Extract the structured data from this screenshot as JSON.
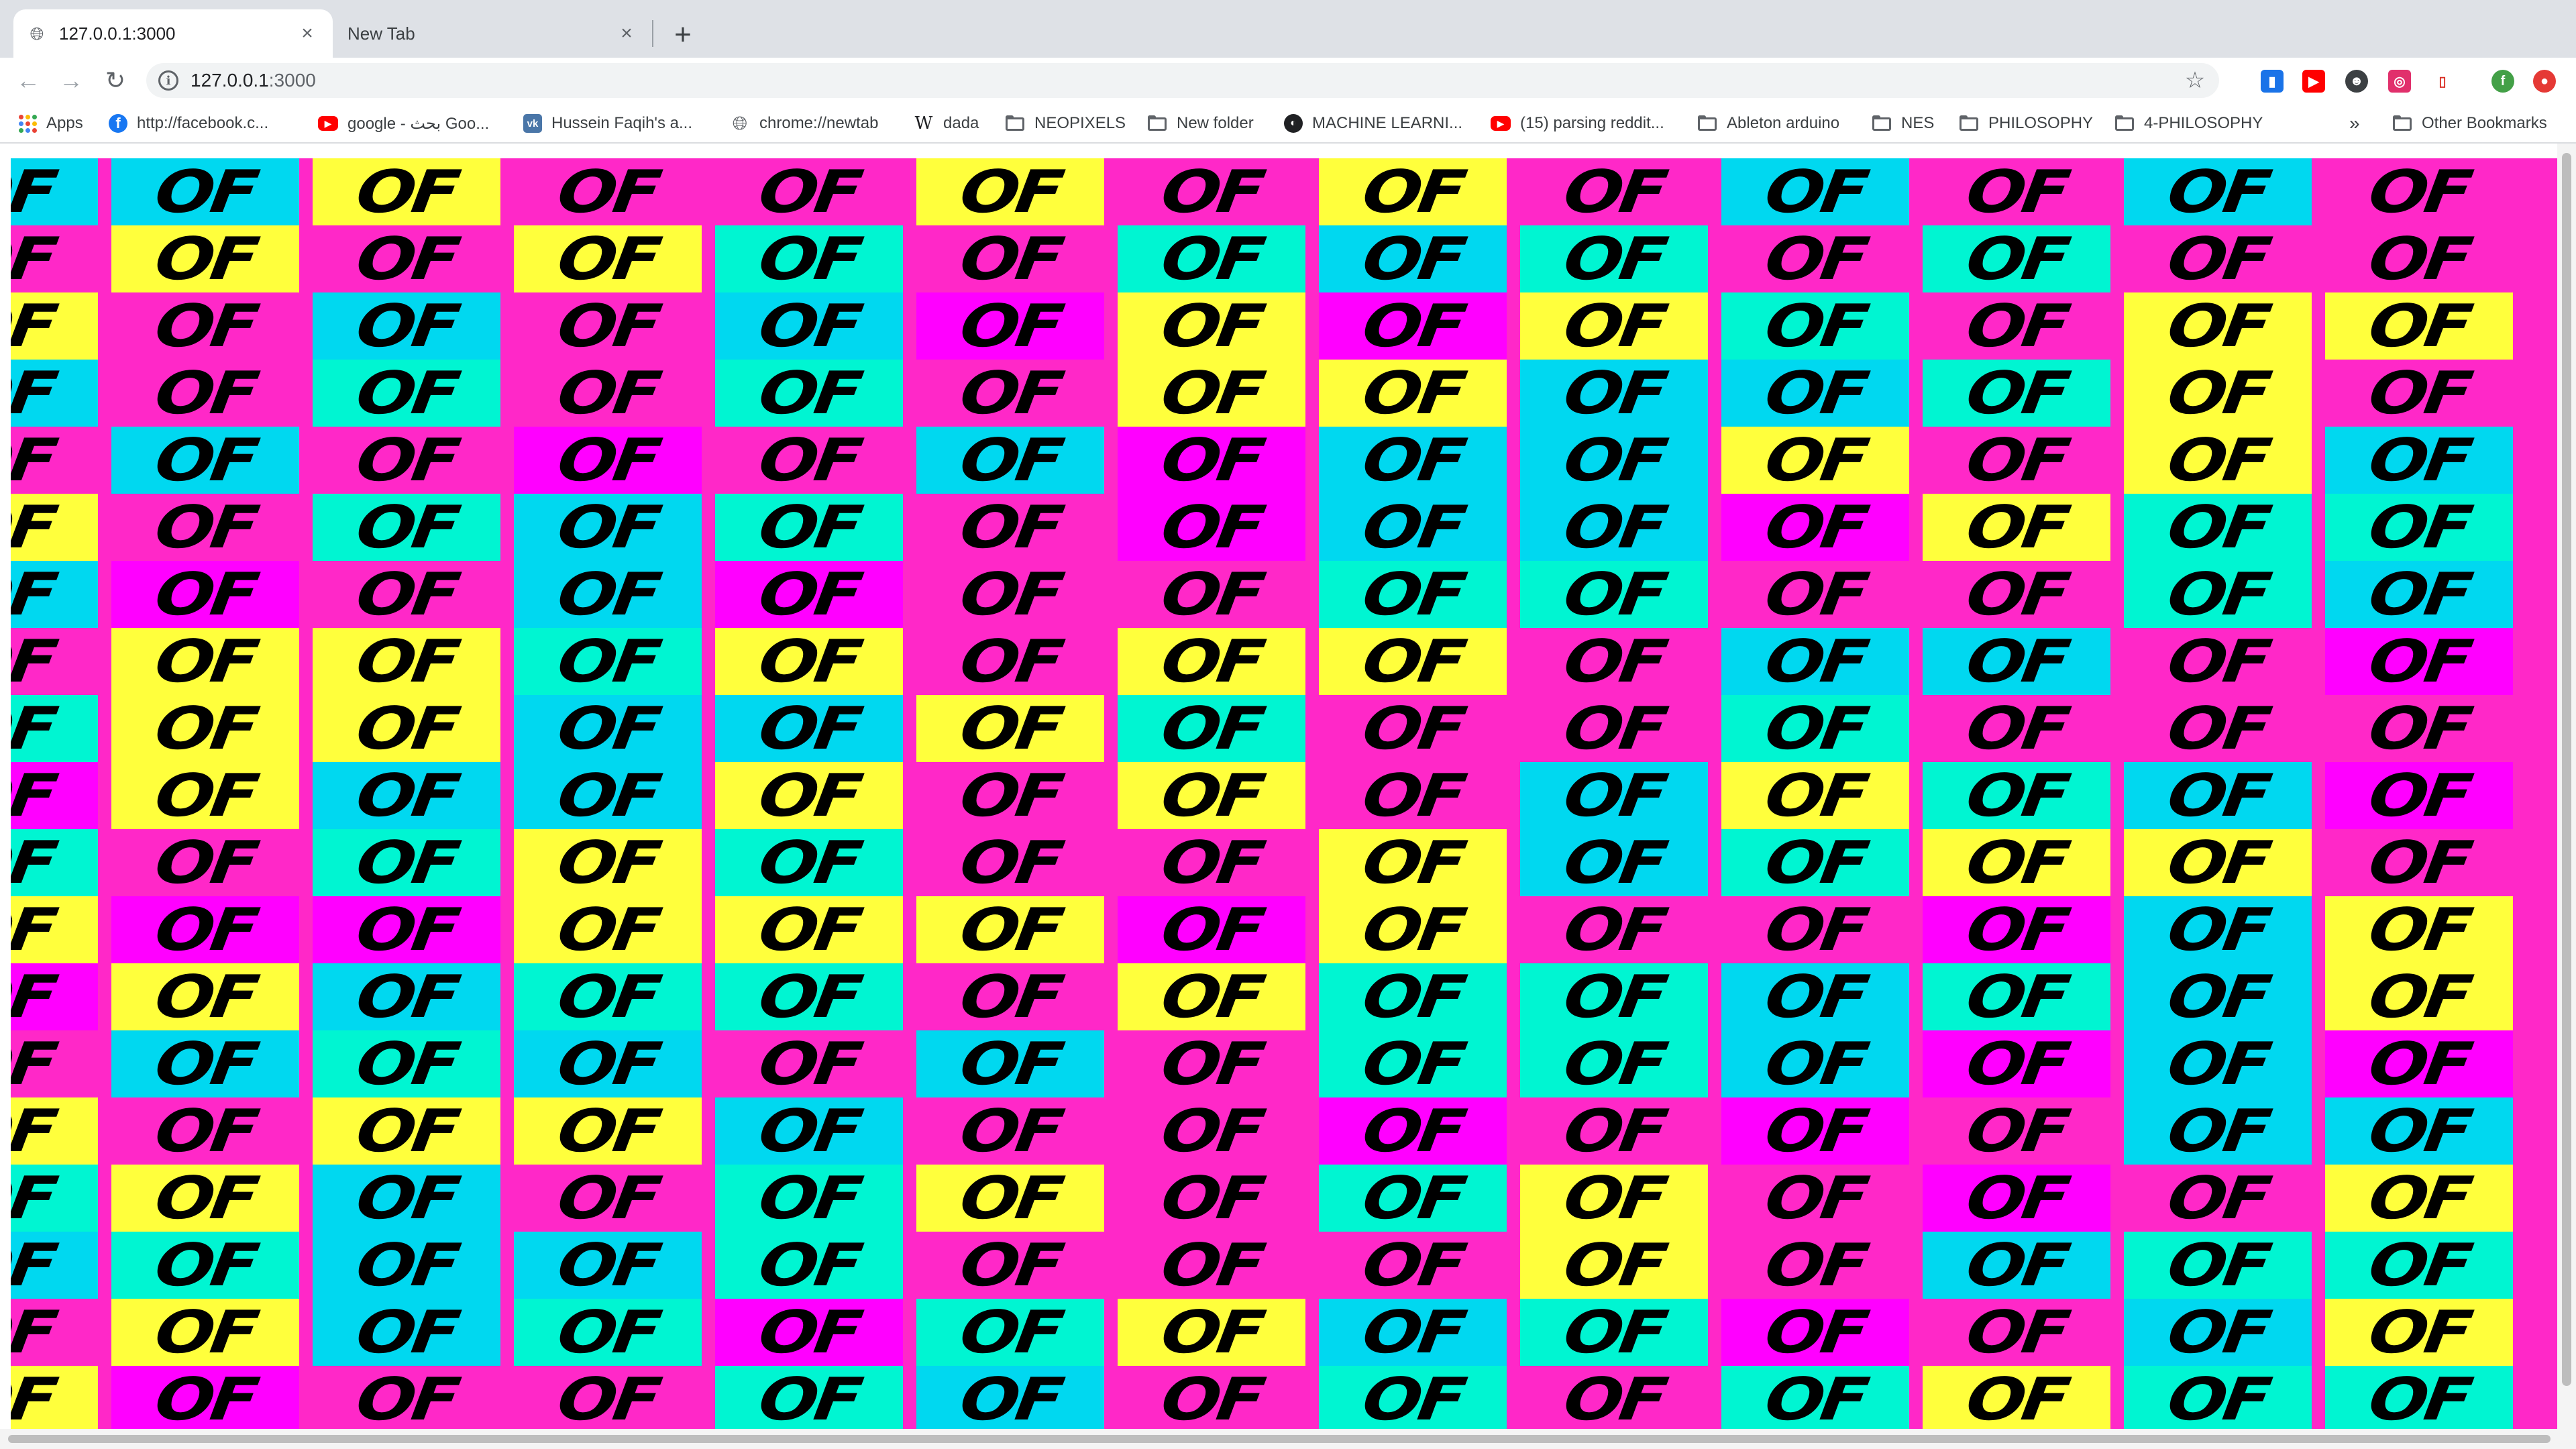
{
  "browser": {
    "tabs": [
      {
        "title": "127.0.0.1:3000",
        "active": true,
        "favicon": "globe-icon"
      },
      {
        "title": "New Tab",
        "active": false
      }
    ],
    "address_bar": {
      "host": "127.0.0.1",
      "port": ":3000"
    },
    "bookmarks": [
      {
        "label": "Apps",
        "icon": "apps-grid-icon"
      },
      {
        "label": "http://facebook.c...",
        "icon": "facebook-icon"
      },
      {
        "label": "google - بحث Goo...",
        "icon": "youtube-icon"
      },
      {
        "label": "Hussein Faqih's a...",
        "icon": "vk-icon"
      },
      {
        "label": "chrome://newtab",
        "icon": "globe-icon"
      },
      {
        "label": "dada",
        "icon": "wikipedia-icon"
      },
      {
        "label": "NEOPIXELS",
        "icon": "folder-icon"
      },
      {
        "label": "New folder",
        "icon": "folder-icon"
      },
      {
        "label": "MACHINE LEARNI...",
        "icon": "ml-icon"
      },
      {
        "label": "(15) parsing reddit...",
        "icon": "youtube-icon"
      },
      {
        "label": "Ableton arduino",
        "icon": "folder-icon"
      },
      {
        "label": "NES",
        "icon": "folder-icon"
      },
      {
        "label": "PHILOSOPHY",
        "icon": "folder-icon"
      },
      {
        "label": "4-PHILOSOPHY",
        "icon": "folder-icon"
      }
    ],
    "overflow_label": "»",
    "other_bookmarks": "Other Bookmarks"
  },
  "page": {
    "tile_text": "OF",
    "colors": {
      "magenta": "#ff28c8",
      "violet": "#ff00ff",
      "yellow": "#ffff3c",
      "cyan": "#00d8f0",
      "mint": "#00f5d2"
    },
    "grid_codes": [
      "CCYMMYMYMCMCM",
      "MYMYTMTCTMTMM",
      "YMCMCVYVYTMYY",
      "CMTMTMYYCCTYM",
      "MCMVMCVCCYMYC",
      "YMTCTMVCCVYTT",
      "CVMCVMMTTMMTC",
      "MYYTYMYYMCCMV",
      "TYYCCYTMMTMMM",
      "VYCCYMYMCYTCV",
      "TMTYTMMYCTYYM",
      "YVVYYYVYMMVCY",
      "VYCTTMYTTCTCY",
      "MCTCMCMTTCVCV",
      "YMYYCMMVMVMCC",
      "TYCMTYMTYMVMY",
      "CTCCTMMMYMCTT",
      "MYCTVTYCTVMCY",
      "YVMMTCMTMTYTT"
    ]
  }
}
